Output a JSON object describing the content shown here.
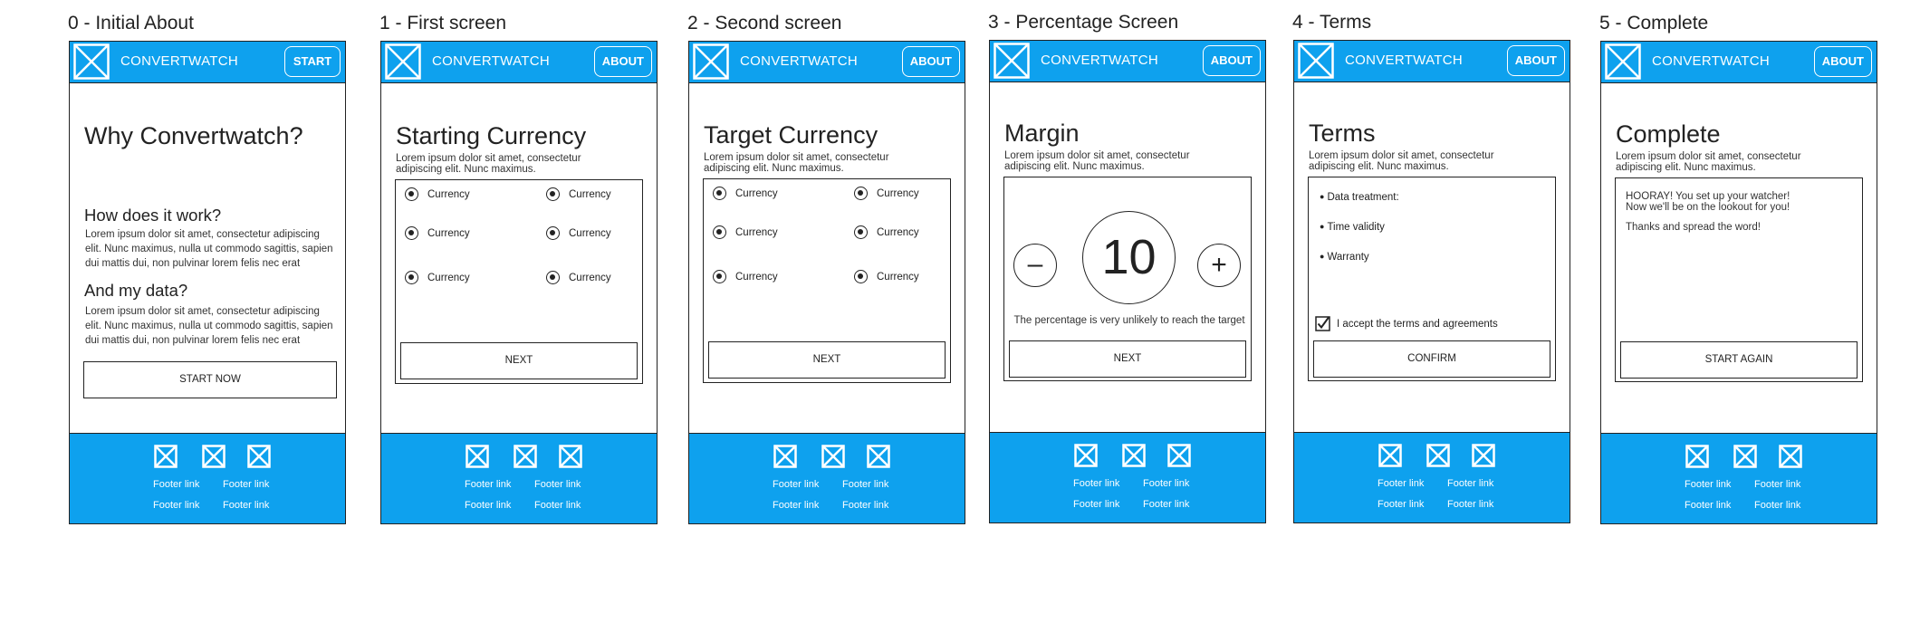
{
  "brand": "CONVERTWATCH",
  "accent_color": "#0ea1ee",
  "footer": {
    "links": [
      "Footer link",
      "Footer link",
      "Footer link",
      "Footer link"
    ],
    "icons": [
      "image-placeholder-icon",
      "image-placeholder-icon",
      "image-placeholder-icon"
    ]
  },
  "screens": [
    {
      "title": "0 - Initial About",
      "header_button": "START",
      "heading": "Why Convertwatch?",
      "sections": [
        {
          "heading": "How does it work?",
          "text": "Lorem ipsum dolor sit amet, consectetur adipiscing elit. Nunc maximus, nulla ut commodo sagittis, sapien dui mattis dui, non pulvinar lorem felis nec erat"
        },
        {
          "heading": "And my data?",
          "text": "Lorem ipsum dolor sit amet, consectetur adipiscing elit. Nunc maximus, nulla ut commodo sagittis, sapien dui mattis dui, non pulvinar lorem felis nec erat"
        }
      ],
      "button": "START NOW"
    },
    {
      "title": "1 - First screen",
      "header_button": "ABOUT",
      "heading": "Starting Currency",
      "subtitle": "Lorem ipsum dolor sit amet, consectetur adipiscing elit. Nunc maximus.",
      "options": [
        "Currency",
        "Currency",
        "Currency",
        "Currency",
        "Currency",
        "Currency"
      ],
      "button": "NEXT"
    },
    {
      "title": "2 - Second screen",
      "header_button": "ABOUT",
      "heading": "Target Currency",
      "subtitle": "Lorem ipsum dolor sit amet, consectetur adipiscing elit. Nunc maximus.",
      "options": [
        "Currency",
        "Currency",
        "Currency",
        "Currency",
        "Currency",
        "Currency"
      ],
      "button": "NEXT"
    },
    {
      "title": "3 - Percentage Screen",
      "header_button": "ABOUT",
      "heading": "Margin",
      "subtitle": "Lorem ipsum dolor sit amet, consectetur adipiscing elit. Nunc maximus.",
      "value": "10",
      "minus": "–",
      "plus": "+",
      "note": "The percentage is very unlikely to reach the target",
      "button": "NEXT"
    },
    {
      "title": "4 - Terms",
      "header_button": "ABOUT",
      "heading": "Terms",
      "subtitle": "Lorem ipsum dolor sit amet, consectetur adipiscing elit. Nunc maximus.",
      "items": [
        "Data treatment:",
        "Time validity",
        "Warranty"
      ],
      "checkbox_label": "I accept the terms and agreements",
      "button": "CONFIRM"
    },
    {
      "title": "5 - Complete",
      "header_button": "ABOUT",
      "heading": "Complete",
      "subtitle": "Lorem ipsum dolor sit amet, consectetur adipiscing elit. Nunc maximus.",
      "message_line1": "HOORAY! You set up your watcher!",
      "message_line2": "Now we'll be on the lookout for you!",
      "message_line3": "Thanks and spread the word!",
      "button": "START AGAIN"
    }
  ]
}
